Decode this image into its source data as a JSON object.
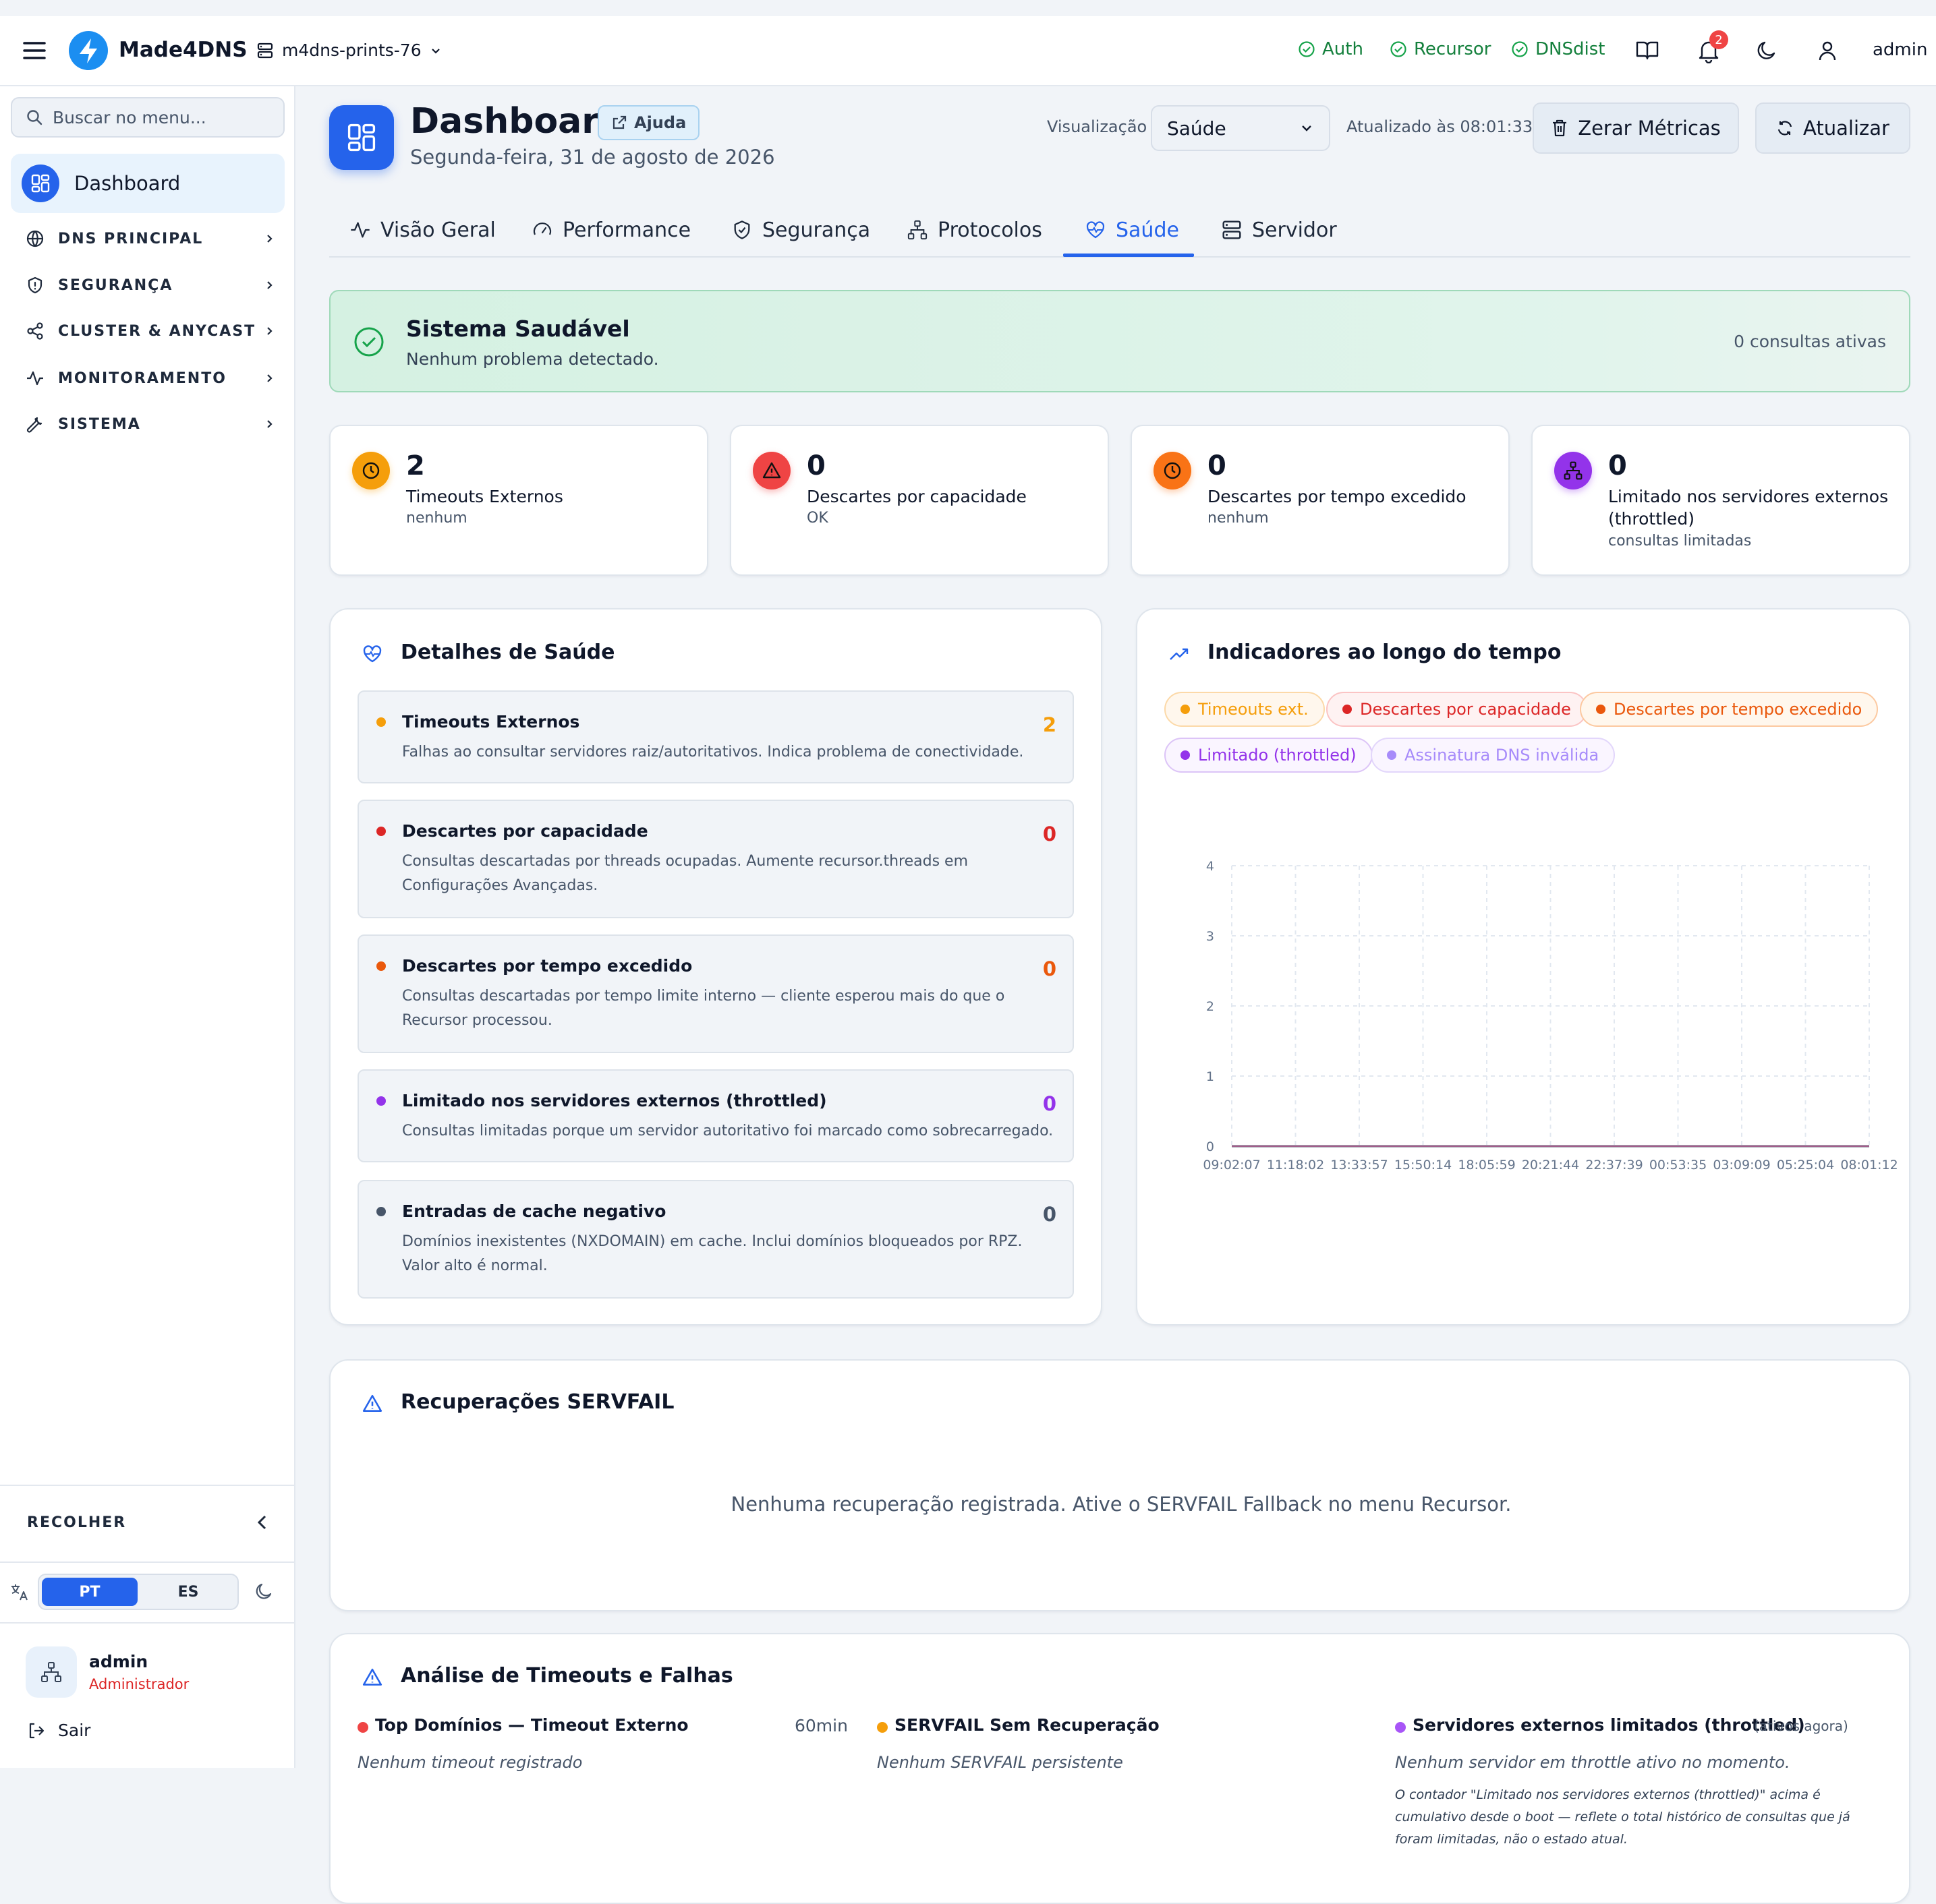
{
  "topbar": {
    "brand": "Made4DNS",
    "server": "m4dns-prints-76",
    "statuses": [
      "Auth",
      "Recursor",
      "DNSdist"
    ],
    "notification_count": "2",
    "user": "admin"
  },
  "sidebar": {
    "search_placeholder": "Buscar no menu...",
    "active_item": "Dashboard",
    "groups": [
      "DNS PRINCIPAL",
      "SEGURANÇA",
      "CLUSTER & ANYCAST",
      "MONITORAMENTO",
      "SISTEMA"
    ],
    "collapse": "RECOLHER",
    "lang_pt": "PT",
    "lang_es": "ES",
    "user_name": "admin",
    "user_role": "Administrador",
    "logout": "Sair"
  },
  "header": {
    "title": "Dashboard",
    "help": "Ajuda",
    "date": "Segunda-feira, 31 de agosto de 2026",
    "view_label": "Visualização",
    "view_value": "Saúde",
    "updated": "Atualizado às 08:01:33",
    "reset_btn": "Zerar Métricas",
    "refresh_btn": "Atualizar"
  },
  "tabs": [
    "Visão Geral",
    "Performance",
    "Segurança",
    "Protocolos",
    "Saúde",
    "Servidor"
  ],
  "active_tab": "Saúde",
  "health_banner": {
    "title": "Sistema Saudável",
    "subtitle": "Nenhum problema detectado.",
    "active_queries": "0 consultas ativas"
  },
  "stats": [
    {
      "value": "2",
      "label": "Timeouts Externos",
      "sub": "nenhum",
      "color": "#f59e0b"
    },
    {
      "value": "0",
      "label": "Descartes por capacidade",
      "sub": "OK",
      "color": "#ef4444"
    },
    {
      "value": "0",
      "label": "Descartes por tempo excedido",
      "sub": "nenhum",
      "color": "#f97316"
    },
    {
      "value": "0",
      "label": "Limitado nos servidores externos (throttled)",
      "sub": "consultas limitadas",
      "color": "#9333ea"
    }
  ],
  "health_details": {
    "title": "Detalhes de Saúde",
    "items": [
      {
        "title": "Timeouts Externos",
        "desc": "Falhas ao consultar servidores raiz/autoritativos. Indica problema de conectividade.",
        "value": "2",
        "color": "#f59e0b"
      },
      {
        "title": "Descartes por capacidade",
        "desc": "Consultas descartadas por threads ocupadas. Aumente recursor.threads em Configurações Avançadas.",
        "value": "0",
        "color": "#dc2626"
      },
      {
        "title": "Descartes por tempo excedido",
        "desc": "Consultas descartadas por tempo limite interno — cliente esperou mais do que o Recursor processou.",
        "value": "0",
        "color": "#ea580c"
      },
      {
        "title": "Limitado nos servidores externos (throttled)",
        "desc": "Consultas limitadas porque um servidor autoritativo foi marcado como sobrecarregado.",
        "value": "0",
        "color": "#9333ea"
      },
      {
        "title": "Entradas de cache negativo",
        "desc": "Domínios inexistentes (NXDOMAIN) em cache. Inclui domínios bloqueados por RPZ. Valor alto é normal.",
        "value": "0",
        "color": "#475569"
      }
    ]
  },
  "indicators": {
    "title": "Indicadores ao longo do tempo",
    "legend": [
      {
        "name": "Timeouts ext.",
        "color": "#f59e0b",
        "bg": "#fff7ed",
        "border": "#fcd9a8"
      },
      {
        "name": "Descartes por capacidade",
        "color": "#dc2626",
        "bg": "#fef2f2",
        "border": "#fbc4c4"
      },
      {
        "name": "Descartes por tempo excedido",
        "color": "#ea580c",
        "bg": "#fff7ed",
        "border": "#fcc9a0"
      },
      {
        "name": "Limitado (throttled)",
        "color": "#9333ea",
        "bg": "#faf5ff",
        "border": "#dcc4f7"
      },
      {
        "name": "Assinatura DNS inválida",
        "color": "#a78bfa",
        "bg": "#faf5ff",
        "border": "#e2d6fb"
      }
    ]
  },
  "chart_data": {
    "type": "line",
    "x": [
      "09:02:07",
      "11:18:02",
      "13:33:57",
      "15:50:14",
      "18:05:59",
      "20:21:44",
      "22:37:39",
      "00:53:35",
      "03:09:09",
      "05:25:04",
      "08:01:12"
    ],
    "ylim": [
      0,
      4
    ],
    "yticks": [
      "0",
      "1",
      "2",
      "3",
      "4"
    ],
    "grid": true,
    "legend": "top",
    "series": [
      {
        "name": "Timeouts ext.",
        "values": [
          0,
          0,
          0,
          0,
          0,
          0,
          0,
          0,
          0,
          0,
          0
        ]
      },
      {
        "name": "Descartes por capacidade",
        "values": [
          0,
          0,
          0,
          0,
          0,
          0,
          0,
          0,
          0,
          0,
          0
        ]
      },
      {
        "name": "Descartes por tempo excedido",
        "values": [
          0,
          0,
          0,
          0,
          0,
          0,
          0,
          0,
          0,
          0,
          0
        ]
      },
      {
        "name": "Limitado (throttled)",
        "values": [
          0,
          0,
          0,
          0,
          0,
          0,
          0,
          0,
          0,
          0,
          0
        ]
      },
      {
        "name": "Assinatura DNS inválida",
        "values": [
          0,
          0,
          0,
          0,
          0,
          0,
          0,
          0,
          0,
          0,
          0
        ]
      }
    ]
  },
  "servfail": {
    "title": "Recuperações SERVFAIL",
    "empty": "Nenhuma recuperação registrada. Ative o SERVFAIL Fallback no menu Recursor."
  },
  "analysis": {
    "title": "Análise de Timeouts e Falhas",
    "col1_title": "Top Domínios — Timeout Externo",
    "col1_range": "60min",
    "col1_empty": "Nenhum timeout registrado",
    "col2_title": "SERVFAIL Sem Recuperação",
    "col2_empty": "Nenhum SERVFAIL persistente",
    "col3_title": "Servidores externos limitados (throttled)",
    "col3_tag": "(ativos agora)",
    "col3_empty": "Nenhum servidor em throttle ativo no momento.",
    "col3_note": "O contador \"Limitado nos servidores externos (throttled)\" acima é cumulativo desde o boot — reflete o total histórico de consultas que já foram limitadas, não o estado atual."
  }
}
